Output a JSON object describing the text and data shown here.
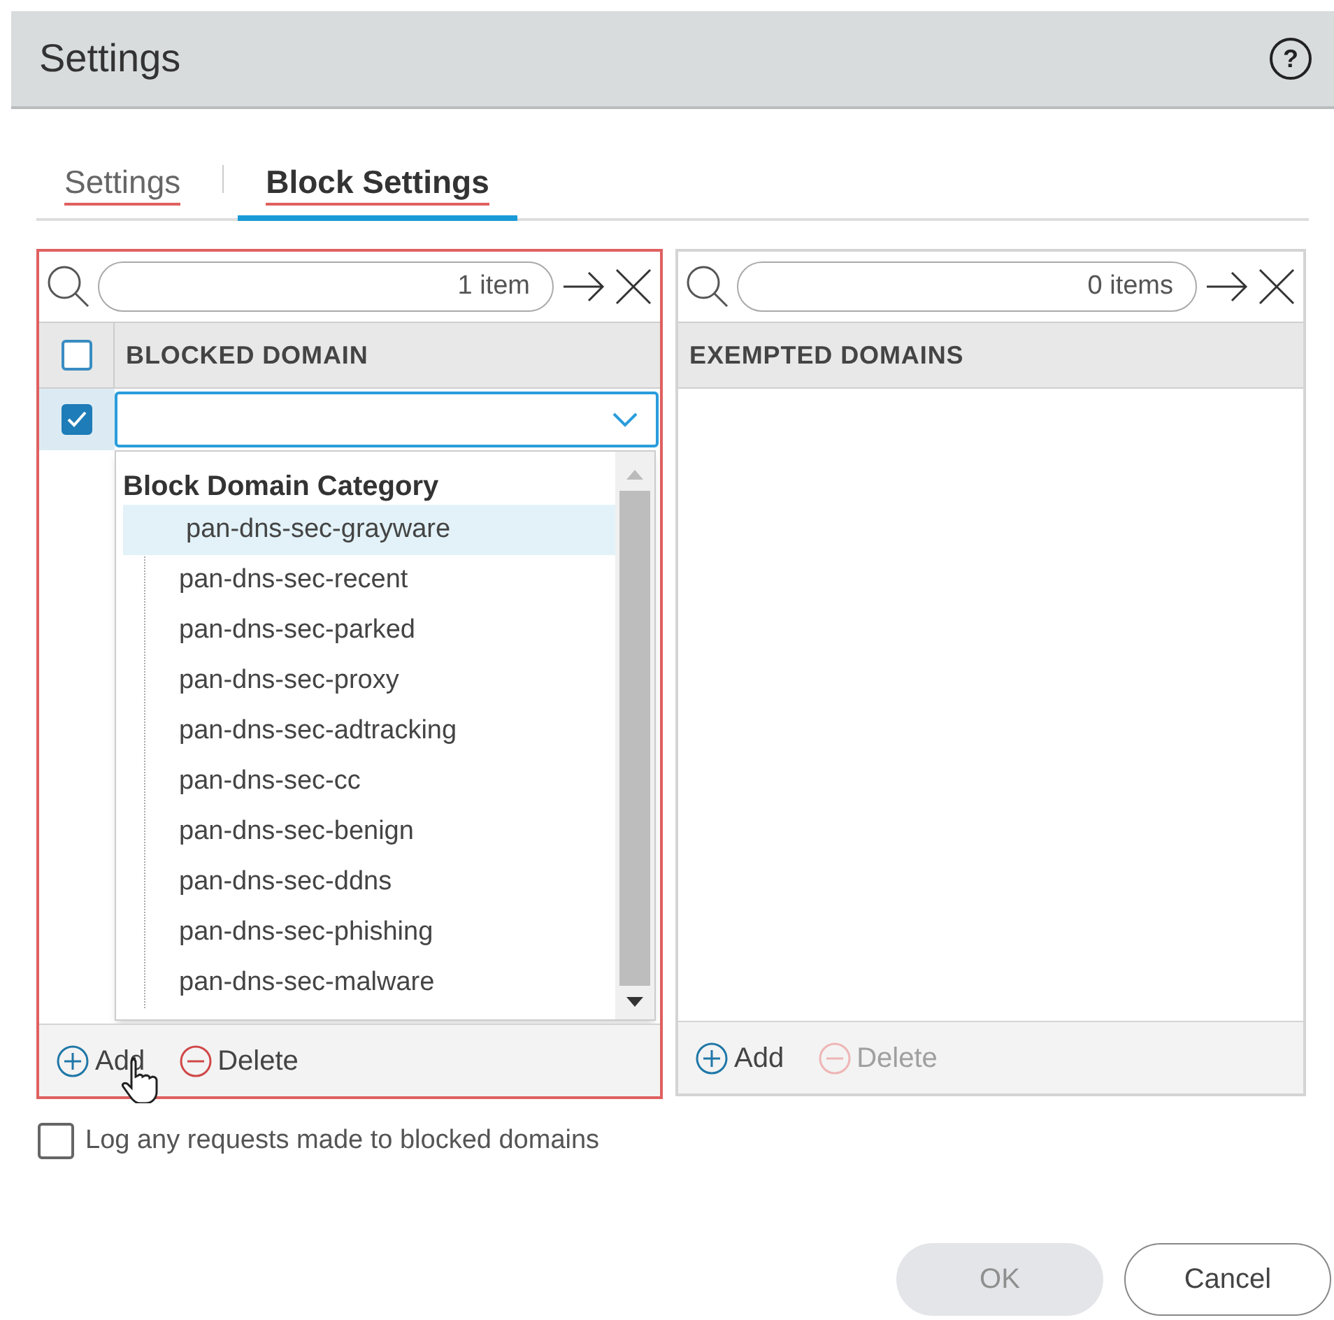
{
  "dialog": {
    "title": "Settings",
    "help": "?"
  },
  "tabs": [
    {
      "label": "Settings",
      "selected": false
    },
    {
      "label": "Block Settings",
      "selected": true
    }
  ],
  "panels": [
    {
      "count": "1 item",
      "column": "BLOCKED DOMAIN",
      "focused": true,
      "header_checked": false,
      "rows": [
        {
          "checked": true
        }
      ],
      "add": "Add",
      "delete": "Delete",
      "delete_disabled": false
    },
    {
      "count": "0 items",
      "column": "EXEMPTED DOMAINS",
      "focused": false,
      "add": "Add",
      "delete": "Delete",
      "delete_disabled": true
    }
  ],
  "dropdown": {
    "group": "Block Domain Category",
    "items": [
      {
        "label": "pan-dns-sec-grayware",
        "selected": true
      },
      {
        "label": "pan-dns-sec-recent",
        "selected": false
      },
      {
        "label": "pan-dns-sec-parked",
        "selected": false
      },
      {
        "label": "pan-dns-sec-proxy",
        "selected": false
      },
      {
        "label": "pan-dns-sec-adtracking",
        "selected": false
      },
      {
        "label": "pan-dns-sec-cc",
        "selected": false
      },
      {
        "label": "pan-dns-sec-benign",
        "selected": false
      },
      {
        "label": "pan-dns-sec-ddns",
        "selected": false
      },
      {
        "label": "pan-dns-sec-phishing",
        "selected": false
      },
      {
        "label": "pan-dns-sec-malware",
        "selected": false
      }
    ]
  },
  "log_option": {
    "label": "Log any requests made to blocked domains",
    "checked": false
  },
  "buttons": [
    {
      "label": "OK",
      "disabled": true
    },
    {
      "label": "Cancel",
      "disabled": false
    }
  ]
}
